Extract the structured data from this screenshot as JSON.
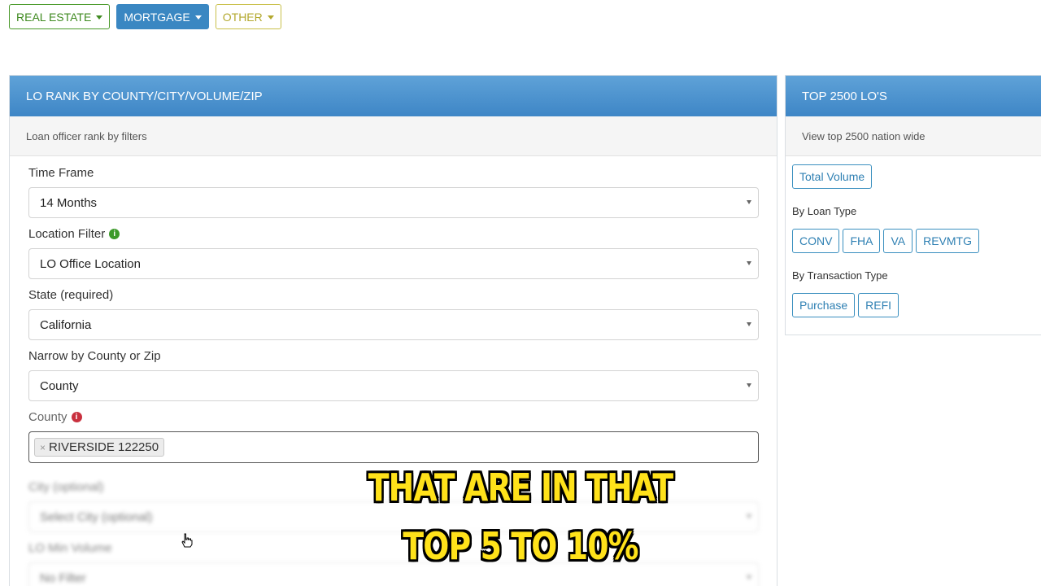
{
  "nav": {
    "real_estate": "REAL ESTATE",
    "mortgage": "MORTGAGE",
    "other": "OTHER"
  },
  "left_panel": {
    "title": "LO RANK BY COUNTY/CITY/VOLUME/ZIP",
    "subtitle": "Loan officer rank by filters",
    "time_frame": {
      "label": "Time Frame",
      "value": "14 Months"
    },
    "location_filter": {
      "label": "Location Filter",
      "value": "LO Office Location"
    },
    "state": {
      "label": "State (required)",
      "value": "California"
    },
    "narrow": {
      "label": "Narrow by County or Zip",
      "value": "County"
    },
    "county": {
      "label": "County",
      "tag": "RIVERSIDE 122250"
    },
    "city": {
      "label": "City (optional)",
      "placeholder": "Select City (optional)"
    },
    "volume": {
      "label": "LO Min Volume",
      "value": "No Filter"
    }
  },
  "right_panel": {
    "title": "TOP 2500 LO'S",
    "subtitle": "View top 2500 nation wide",
    "total_volume": "Total Volume",
    "by_loan_type_label": "By Loan Type",
    "loan_types": [
      "CONV",
      "FHA",
      "VA",
      "REVMTG"
    ],
    "by_transaction_label": "By Transaction Type",
    "transaction_types": [
      "Purchase",
      "REFI"
    ]
  },
  "caption": {
    "line1": "THAT ARE IN THAT",
    "line2": "TOP 5 TO 10%"
  },
  "colors": {
    "header_blue": "#3e86c6",
    "caption_yellow": "#ffe21a",
    "real_estate_green": "#3f8a20",
    "other_olive": "#b3a82e"
  }
}
